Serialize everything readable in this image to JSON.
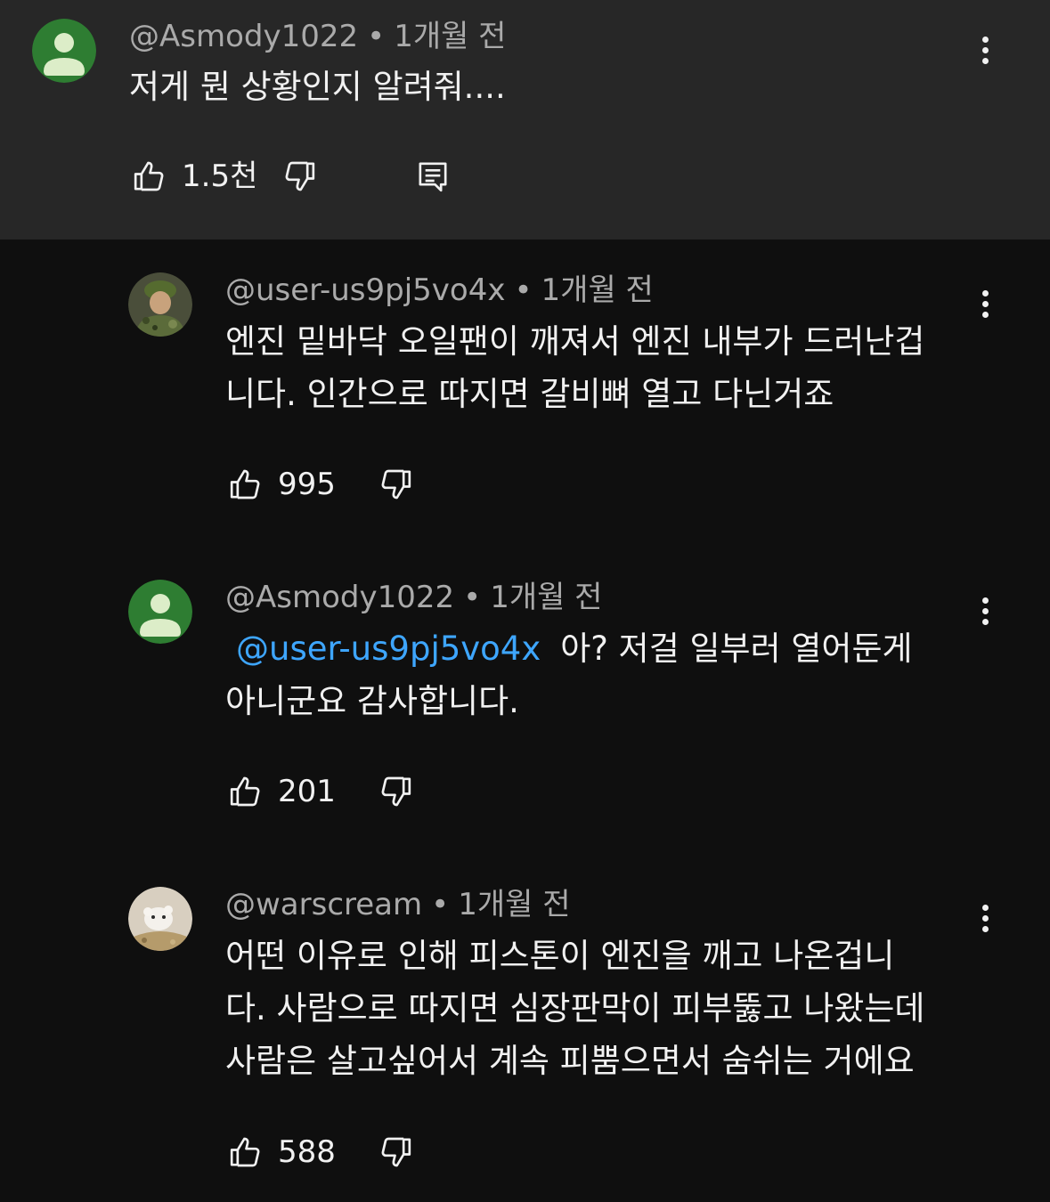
{
  "colors": {
    "parent_bg": "#272727",
    "page_bg": "#0f0f0f",
    "mention": "#3ea6ff",
    "meta": "#aaaaaa"
  },
  "comments": [
    {
      "handle": "@Asmody1022",
      "time": "1개월 전",
      "lines": [
        "저게 뭔 상황인지 알려줘...."
      ],
      "likes": "1.5천",
      "avatar": "default-green-avatar",
      "has_reply_button": true
    },
    {
      "handle": "@user-us9pj5vo4x",
      "time": "1개월 전",
      "lines": [
        "엔진 밑바닥 오일팬이 깨져서 엔진 내부가 드러난겁",
        "니다. 인간으로 따지면 갈비뼈 열고 다닌거죠"
      ],
      "likes": "995",
      "avatar": "soldier-photo-avatar"
    },
    {
      "handle": "@Asmody1022",
      "time": "1개월 전",
      "mention": "@user-us9pj5vo4x",
      "lines": [
        "아? 저걸 일부러 열어둔게",
        "아니군요 감사합니다."
      ],
      "likes": "201",
      "avatar": "default-green-avatar"
    },
    {
      "handle": "@warscream",
      "time": "1개월 전",
      "lines": [
        "어떤 이유로 인해 피스톤이 엔진을 깨고 나온겁니",
        "다. 사람으로 따지면 심장판막이 피부뚫고 나왔는데",
        "사람은 살고싶어서 계속 피뿜으면서 숨쉬는 거에요"
      ],
      "likes": "588",
      "avatar": "hamster-photo-avatar"
    }
  ],
  "separator": "•",
  "icons": {
    "like": "thumbs-up-icon",
    "dislike": "thumbs-down-icon",
    "reply": "reply-icon",
    "more": "more-vert-icon"
  }
}
